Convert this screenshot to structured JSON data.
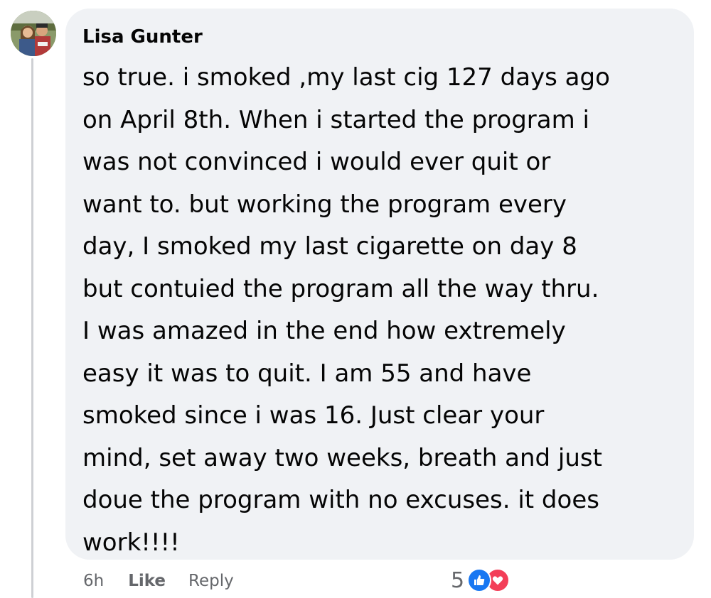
{
  "comment": {
    "author": "Lisa Gunter",
    "lines": [
      "so true. i smoked ,my last cig 127 days ago",
      "on April 8th. When i started the program i",
      "was not convinced i would ever quit or",
      "want to. but working the program every",
      "day, I smoked my last cigarette on day 8",
      "but contuied the program all the way thru.",
      "I was amazed in the end how extremely",
      "easy it was to quit. I am 55 and have",
      "smoked since i was 16. Just clear your",
      "mind, set away two weeks, breath and just",
      "doue the program with no excuses. it does",
      "work!!!!"
    ]
  },
  "actions": {
    "time": "6h",
    "like_label": "Like",
    "reply_label": "Reply"
  },
  "reactions": {
    "count": "5",
    "icons": [
      "like-icon",
      "love-icon"
    ]
  },
  "colors": {
    "bubble": "#f0f2f5",
    "text": "#050505",
    "secondary": "#65676b",
    "like": "#1877f2",
    "love": "#f33e58",
    "thread_line": "#ced0d4"
  }
}
